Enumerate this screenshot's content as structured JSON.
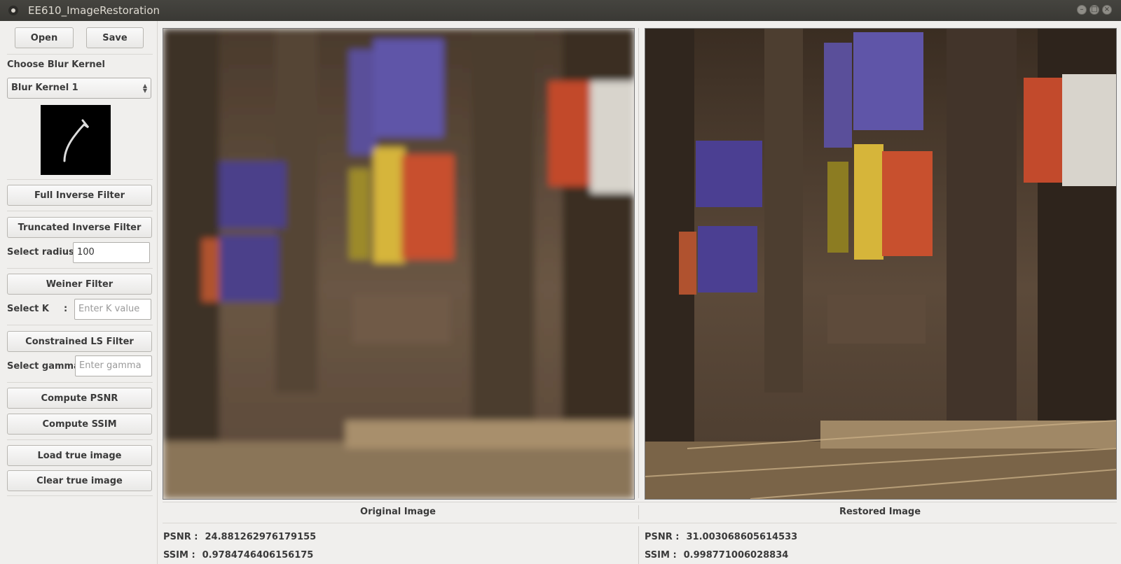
{
  "window": {
    "title": "EE610_ImageRestoration"
  },
  "toolbar": {
    "open_label": "Open",
    "save_label": "Save"
  },
  "kernel": {
    "section_label": "Choose Blur Kernel",
    "selected": "Blur Kernel 1"
  },
  "filters": {
    "full_inverse": "Full Inverse Filter",
    "truncated_inverse": "Truncated Inverse Filter",
    "radius_label": "Select radius :",
    "radius_value": "100",
    "weiner": "Weiner Filter",
    "k_label": "Select K",
    "k_colon": ":",
    "k_placeholder": "Enter K value",
    "cls": "Constrained LS Filter",
    "gamma_label": "Select gamma:",
    "gamma_placeholder": "Enter gamma"
  },
  "metrics_buttons": {
    "psnr": "Compute PSNR",
    "ssim": "Compute SSIM"
  },
  "true_image": {
    "load": "Load true image",
    "clear": "Clear true image"
  },
  "panels": {
    "original": {
      "caption": "Original Image",
      "psnr_label": "PSNR :",
      "psnr": "24.881262976179155",
      "ssim_label": "SSIM :",
      "ssim": "0.9784746406156175"
    },
    "restored": {
      "caption": "Restored Image",
      "psnr_label": "PSNR :",
      "psnr": "31.003068605614533",
      "ssim_label": "SSIM :",
      "ssim": "0.998771006028834"
    }
  },
  "colors": {
    "window_bg": "#f0efed",
    "titlebar": "#3c3b37"
  }
}
